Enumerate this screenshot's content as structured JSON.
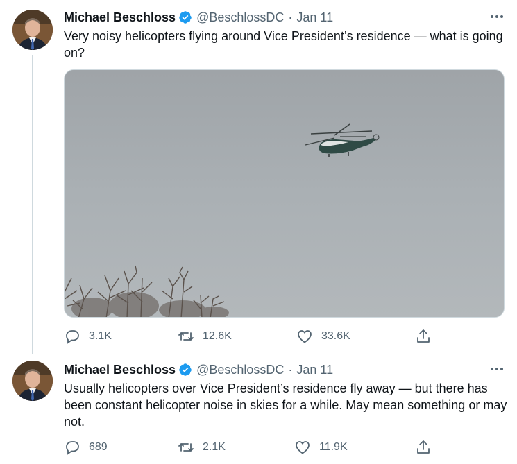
{
  "tweets": [
    {
      "author_name": "Michael Beschloss",
      "handle": "@BeschlossDC",
      "separator": "·",
      "date": "Jan 11",
      "text": "Very noisy helicopters flying around Vice President’s residence — what is going on?",
      "media": {
        "description_icon": "helicopter-photo",
        "sky_color": "#a9aeb1",
        "tree_color": "#5b524c"
      },
      "replies": "3.1K",
      "retweets": "12.6K",
      "likes": "33.6K"
    },
    {
      "author_name": "Michael Beschloss",
      "handle": "@BeschlossDC",
      "separator": "·",
      "date": "Jan 11",
      "text": "Usually helicopters over Vice President’s residence fly away — but there has been constant helicopter noise in skies for a while.  May mean something or may not.",
      "replies": "689",
      "retweets": "2.1K",
      "likes": "11.9K"
    }
  ],
  "colors": {
    "verified_blue": "#1d9bf0",
    "secondary_text": "#536471",
    "thread_line": "#cfd9de"
  }
}
